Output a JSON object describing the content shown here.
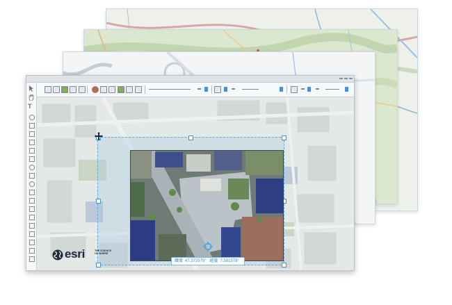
{
  "brand": {
    "logo_word": "esri",
    "logo_tagline": "THE SCIENCE OF WHERE",
    "primary_color": "#1d2a3a",
    "accent_color": "#3d8cc4"
  },
  "map": {
    "selection_color": "#5aa9d6",
    "coordinates": {
      "latitude_label": "緯度",
      "latitude_value": "47.372579°",
      "longitude_label": "經度",
      "longitude_value": "7.581578°"
    }
  },
  "icons": {
    "move": "move-icon",
    "crosshair": "crosshair-icon",
    "select": "select-arrow-icon",
    "pan": "hand-pan-icon",
    "text": "text-icon",
    "globe": "globe-icon"
  },
  "left_tools": {
    "text_tool_glyph": "T"
  }
}
